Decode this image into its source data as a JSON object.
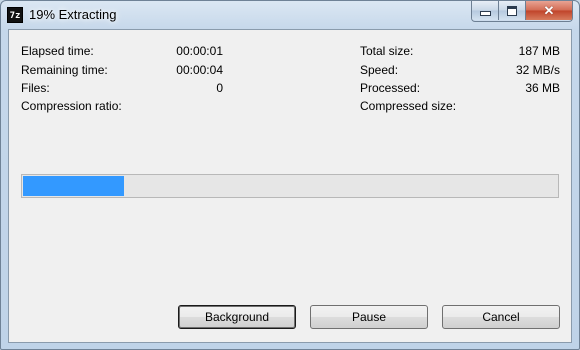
{
  "window": {
    "title": "19% Extracting",
    "app_icon_text": "7z",
    "controls": [
      "minimize",
      "maximize",
      "close"
    ]
  },
  "stats_left": [
    {
      "label": "Elapsed time:",
      "value": "00:00:01"
    },
    {
      "label": "Remaining time:",
      "value": "00:00:04"
    },
    {
      "label": "Files:",
      "value": "0"
    },
    {
      "label": "Compression ratio:",
      "value": ""
    }
  ],
  "stats_right": [
    {
      "label": "Total size:",
      "value": "187 MB"
    },
    {
      "label": "Speed:",
      "value": "32 MB/s"
    },
    {
      "label": "Processed:",
      "value": "36 MB"
    },
    {
      "label": "Compressed size:",
      "value": ""
    }
  ],
  "progress": {
    "fraction": 0.19,
    "color": "#3399ff"
  },
  "buttons": {
    "background": "Background",
    "pause": "Pause",
    "cancel": "Cancel"
  }
}
